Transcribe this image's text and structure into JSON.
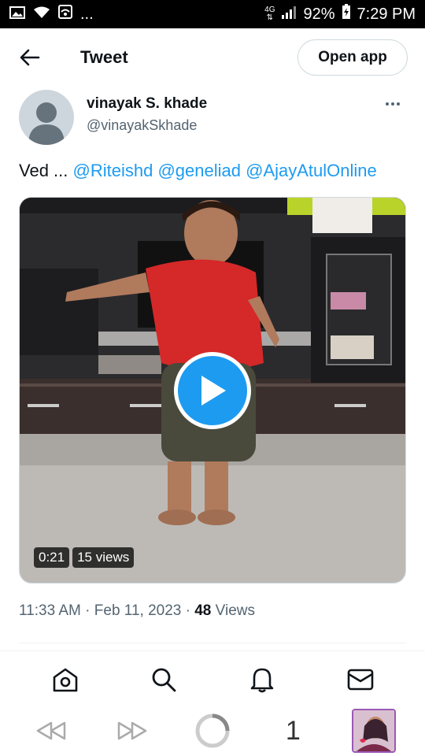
{
  "status_bar": {
    "overflow": "...",
    "network": "4G",
    "battery": "92%",
    "time": "7:29 PM"
  },
  "header": {
    "title": "Tweet",
    "open_app_label": "Open app"
  },
  "author": {
    "name": "vinayak S. khade",
    "handle": "@vinayakSkhade"
  },
  "tweet": {
    "text_prefix": "Ved ...",
    "mentions": [
      "@Riteishd",
      "@geneliad",
      "@AjayAtulOnline"
    ]
  },
  "video": {
    "duration": "0:21",
    "views": "15 views"
  },
  "meta": {
    "time": "11:33 AM",
    "separator": "·",
    "date": "Feb 11, 2023",
    "view_count": "48",
    "views_label": "Views"
  },
  "bottom_nav": {
    "items": [
      "home-icon",
      "search-icon",
      "notifications-icon",
      "messages-icon"
    ]
  },
  "browser_bar": {
    "tab_count": "1"
  },
  "colors": {
    "accent": "#1d9bf0",
    "text": "#0f1419",
    "secondary": "#536471"
  }
}
